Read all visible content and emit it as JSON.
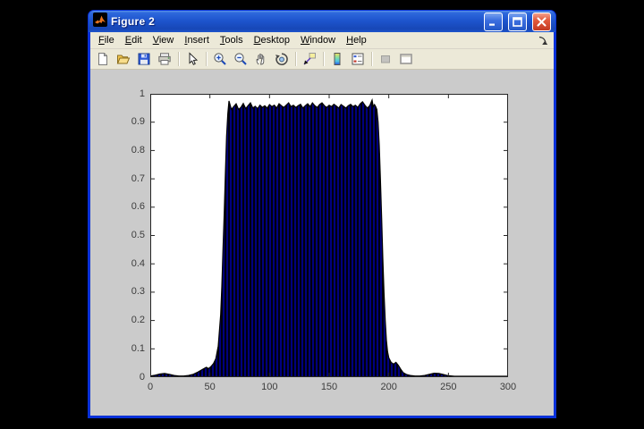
{
  "window": {
    "title": "Figure 2",
    "controls": {
      "minimize_icon": "minimize-icon",
      "maximize_icon": "maximize-icon",
      "close_icon": "close-icon"
    }
  },
  "menu": {
    "items": [
      {
        "label": "File"
      },
      {
        "label": "Edit"
      },
      {
        "label": "View"
      },
      {
        "label": "Insert"
      },
      {
        "label": "Tools"
      },
      {
        "label": "Desktop"
      },
      {
        "label": "Window"
      },
      {
        "label": "Help"
      }
    ],
    "dock_arrow_icon": "dock-figure-arrow-icon"
  },
  "toolbar": {
    "buttons": [
      "new-file-icon",
      "open-folder-icon",
      "save-icon",
      "print-icon",
      "pointer-icon",
      "zoom-in-icon",
      "zoom-out-icon",
      "pan-hand-icon",
      "rotate-3d-icon",
      "data-cursor-icon",
      "colorbar-icon",
      "legend-icon",
      "hide-plot-tools-icon",
      "show-plot-tools-icon"
    ]
  },
  "chart_data": {
    "type": "area",
    "title": "",
    "xlabel": "",
    "ylabel": "",
    "xlim": [
      0,
      300
    ],
    "ylim": [
      0,
      1
    ],
    "x_ticks": [
      0,
      50,
      100,
      150,
      200,
      250,
      300
    ],
    "y_ticks": [
      0,
      0.1,
      0.2,
      0.3,
      0.4,
      0.5,
      0.6,
      0.7,
      0.8,
      0.9,
      1
    ],
    "grid": false,
    "legend": "none",
    "plot_bg": "#FFFFFF",
    "figure_bg": "#CBCBCB",
    "fill_color": "#00007E",
    "stripe_color": "#000000",
    "edge_color": "#000000",
    "series": [
      {
        "name": "dense-oscillating-signal-envelope",
        "x": [
          0,
          4,
          8,
          12,
          16,
          20,
          24,
          28,
          32,
          36,
          40,
          44,
          47,
          49,
          51,
          53,
          55,
          57,
          59,
          60,
          61,
          62,
          63,
          64,
          65,
          66,
          68,
          70,
          72,
          74,
          76,
          78,
          80,
          82,
          84,
          86,
          88,
          90,
          92,
          94,
          96,
          98,
          100,
          102,
          104,
          106,
          108,
          110,
          112,
          114,
          116,
          118,
          120,
          122,
          124,
          126,
          128,
          130,
          132,
          134,
          136,
          138,
          140,
          142,
          144,
          146,
          148,
          150,
          152,
          154,
          156,
          158,
          160,
          162,
          164,
          166,
          168,
          170,
          172,
          174,
          176,
          178,
          180,
          182,
          184,
          186,
          187,
          188,
          189,
          190,
          191,
          192,
          193,
          194,
          195,
          196,
          197,
          198,
          199,
          200,
          202,
          204,
          206,
          208,
          210,
          212,
          215,
          218,
          222,
          226,
          230,
          234,
          238,
          242,
          246,
          250,
          255,
          260,
          270,
          280,
          290,
          300
        ],
        "y": [
          0.004,
          0.007,
          0.011,
          0.013,
          0.01,
          0.006,
          0.004,
          0.004,
          0.006,
          0.01,
          0.018,
          0.028,
          0.035,
          0.03,
          0.038,
          0.048,
          0.065,
          0.11,
          0.22,
          0.32,
          0.45,
          0.58,
          0.72,
          0.85,
          0.93,
          0.975,
          0.945,
          0.955,
          0.965,
          0.945,
          0.952,
          0.966,
          0.948,
          0.958,
          0.968,
          0.95,
          0.956,
          0.948,
          0.96,
          0.952,
          0.958,
          0.95,
          0.962,
          0.955,
          0.96,
          0.95,
          0.965,
          0.958,
          0.952,
          0.96,
          0.968,
          0.955,
          0.96,
          0.952,
          0.958,
          0.963,
          0.95,
          0.958,
          0.965,
          0.955,
          0.968,
          0.958,
          0.952,
          0.962,
          0.968,
          0.958,
          0.952,
          0.96,
          0.955,
          0.963,
          0.957,
          0.95,
          0.962,
          0.956,
          0.95,
          0.958,
          0.963,
          0.955,
          0.96,
          0.952,
          0.965,
          0.972,
          0.96,
          0.95,
          0.958,
          0.978,
          0.955,
          0.962,
          0.955,
          0.945,
          0.9,
          0.82,
          0.7,
          0.56,
          0.42,
          0.3,
          0.2,
          0.13,
          0.09,
          0.068,
          0.052,
          0.046,
          0.052,
          0.042,
          0.028,
          0.016,
          0.009,
          0.006,
          0.004,
          0.004,
          0.006,
          0.01,
          0.014,
          0.013,
          0.009,
          0.005,
          0.003,
          0.003,
          0.003,
          0.003,
          0.003,
          0.003
        ]
      }
    ]
  }
}
